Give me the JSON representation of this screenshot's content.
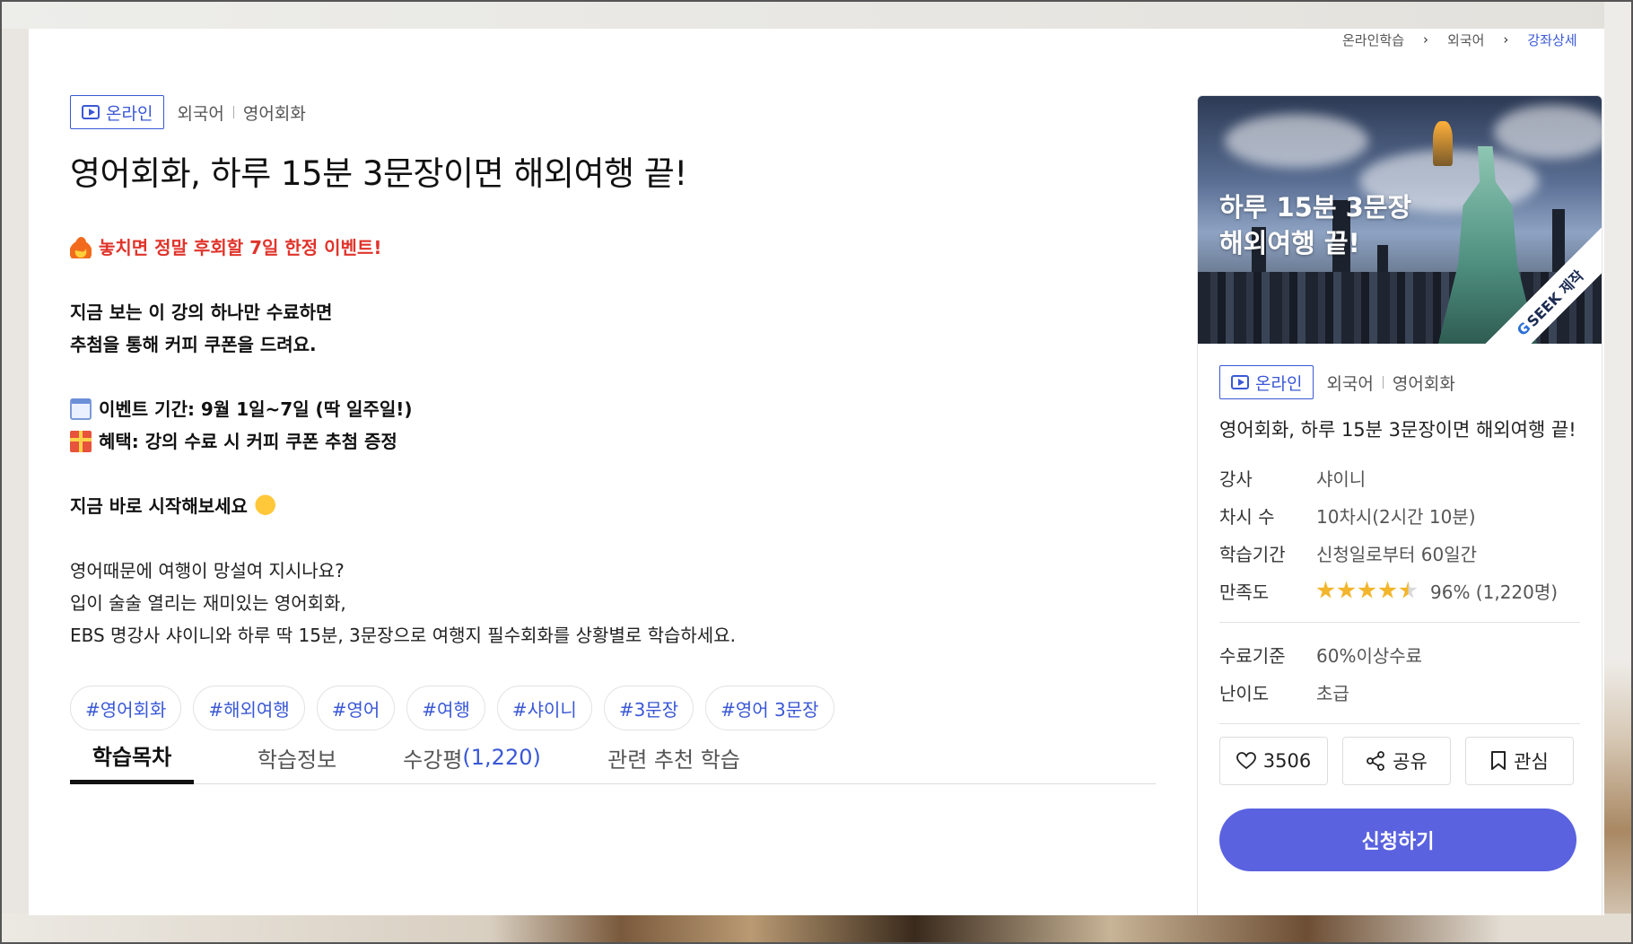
{
  "breadcrumb": [
    {
      "label": "온라인학습"
    },
    {
      "label": "외국어"
    },
    {
      "label": "강좌상세"
    }
  ],
  "badge": {
    "label": "온라인",
    "icon": "play-icon",
    "color": "#3a58d6"
  },
  "category": {
    "primary": "외국어",
    "secondary": "영어회화"
  },
  "course": {
    "title": "영어회화, 하루 15분 3문장이면 해외여행 끝!"
  },
  "description": {
    "event_headline": "놓치면 정말 후회할 7일 한정 이벤트!",
    "intro_line1": "지금 보는 이 강의 하나만 수료하면",
    "intro_line2": "추첨을 통해 커피 쿠폰을 드려요.",
    "period": "이벤트 기간: 9월 1일~7일 (딱 일주일!)",
    "benefit": "혜택: 강의 수료 시 커피 쿠폰 추첨 증정",
    "cta": "지금 바로 시작해보세요",
    "body_line1": "영어때문에 여행이 망설여 지시나요?",
    "body_line2": "입이 술술 열리는 재미있는 영어회화,",
    "body_line3": "EBS 명강사 샤이니와 하루 딱 15분, 3문장으로 여행지 필수회화를 상황별로 학습하세요."
  },
  "tags": [
    {
      "label": "#영어회화"
    },
    {
      "label": "#해외여행"
    },
    {
      "label": "#영어"
    },
    {
      "label": "#여행"
    },
    {
      "label": "#샤이니"
    },
    {
      "label": "#3문장"
    },
    {
      "label": "#영어 3문장"
    }
  ],
  "tabs": [
    {
      "label": "학습목차",
      "active": true
    },
    {
      "label": "학습정보"
    },
    {
      "label": "수강평",
      "count": "(1,220)"
    },
    {
      "label": "관련 추천 학습"
    }
  ],
  "card": {
    "thumb_line1": "하루 15분 3문장",
    "thumb_line2": "해외여행 끝!",
    "ribbon_g": "G",
    "ribbon_text": "SEEK 제작",
    "title": "영어회화, 하루 15분 3문장이면 해외여행 끝!",
    "info": [
      {
        "key": "강사",
        "value": "샤이니"
      },
      {
        "key": "차시 수",
        "value": "10차시(2시간 10분)"
      },
      {
        "key": "학습기간",
        "value": "신청일로부터 60일간"
      },
      {
        "key": "만족도",
        "value": "96% (1,220명)",
        "rating": 4.5
      }
    ],
    "info2": [
      {
        "key": "수료기준",
        "value": "60%이상수료"
      },
      {
        "key": "난이도",
        "value": "초급"
      }
    ],
    "like_count": "3506",
    "share_label": "공유",
    "bookmark_label": "관심",
    "apply_label": "신청하기",
    "apply_color": "#5a62e0"
  }
}
